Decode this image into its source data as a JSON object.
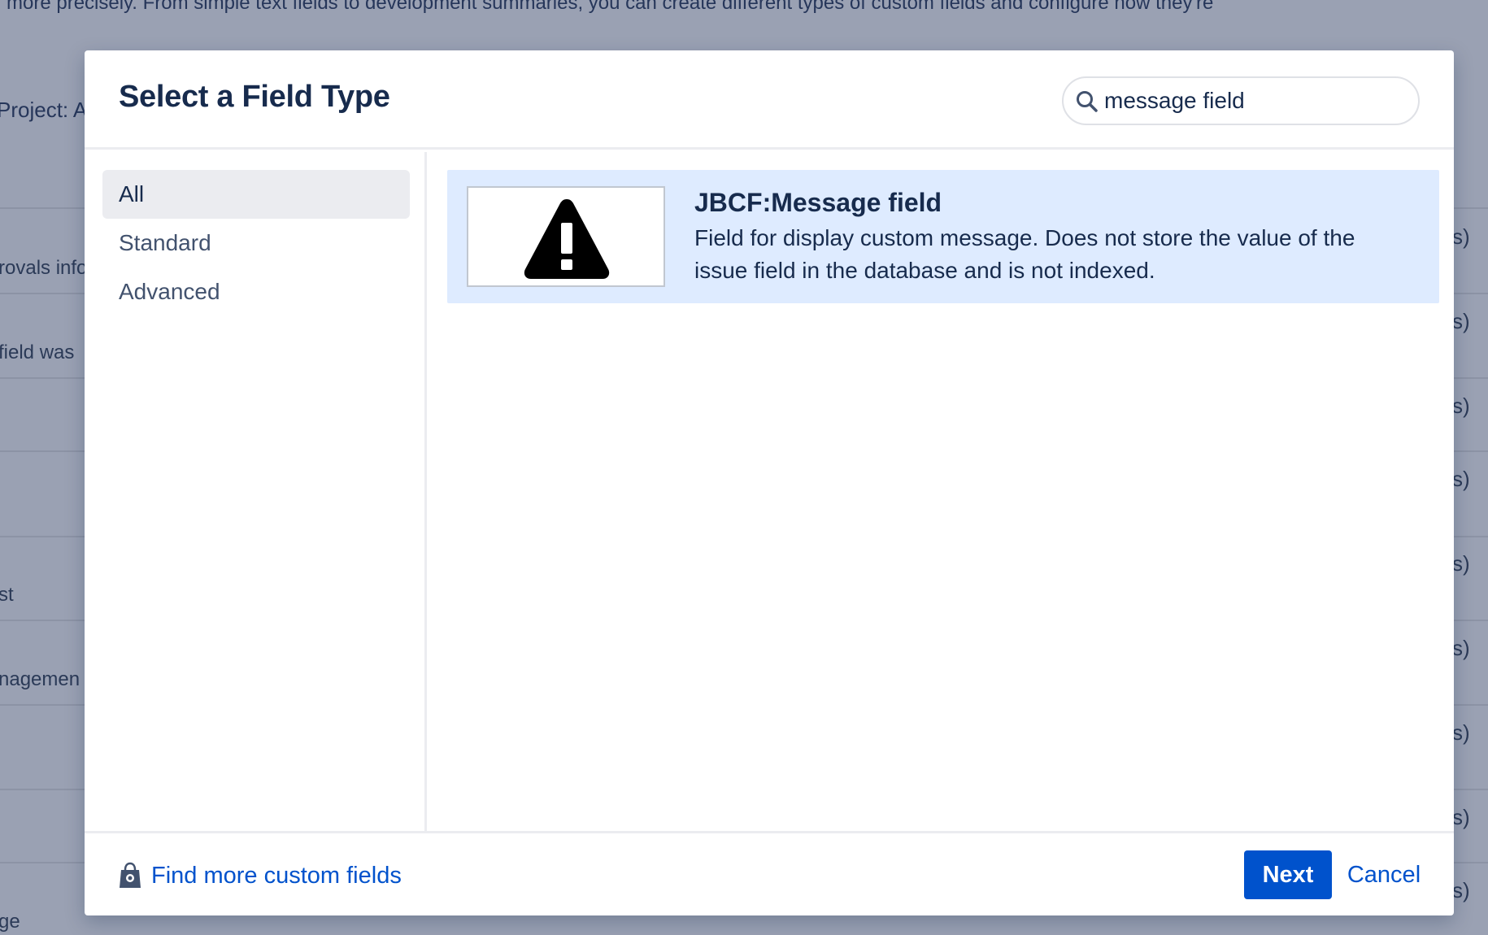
{
  "background": {
    "intro_text": "more precisely. From simple text fields to development summaries, you can create different types of custom fields and configure how they're",
    "project_label": "Project: A",
    "left_fragments": [
      "rovals info",
      "field was",
      "st",
      "nagemen",
      "ge"
    ],
    "right_fragment": "s)"
  },
  "modal": {
    "title": "Select a Field Type",
    "search": {
      "value": "message field",
      "icon": "search-icon"
    },
    "categories": [
      {
        "label": "All",
        "active": true
      },
      {
        "label": "Standard",
        "active": false
      },
      {
        "label": "Advanced",
        "active": false
      }
    ],
    "results": [
      {
        "title": "JBCF:Message field",
        "description": "Field for display custom message. Does not store the value of the issue field in the database and is not indexed.",
        "icon": "warning-icon"
      }
    ],
    "footer": {
      "find_more_label": "Find more custom fields",
      "find_more_icon": "marketplace-bag-icon",
      "next_label": "Next",
      "cancel_label": "Cancel"
    }
  },
  "colors": {
    "primary": "#0052cc",
    "selected_bg": "#deebff",
    "overlay": "#9aa1b3",
    "text": "#172b4d"
  }
}
